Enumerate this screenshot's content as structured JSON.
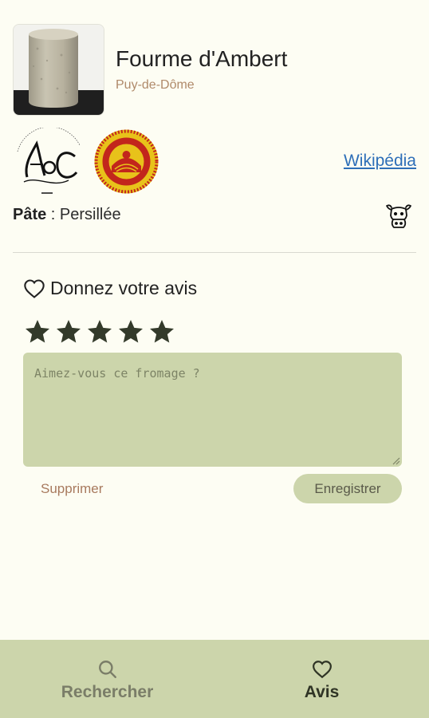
{
  "cheese": {
    "name": "Fourme d'Ambert",
    "region": "Puy-de-Dôme",
    "image_alt": "cheese-photo",
    "wiki_label": "Wikipédia",
    "pate_label": "Pâte",
    "pate_separator": " : ",
    "pate_value": "Persillée",
    "milk_icon": "cow-icon",
    "labels": [
      {
        "name": "AOC",
        "icon": "aoc-logo"
      },
      {
        "name": "AOP",
        "icon": "aop-logo"
      }
    ]
  },
  "review": {
    "title": "Donnez votre avis",
    "rating": 5,
    "max_rating": 5,
    "placeholder": "Aimez-vous ce fromage ?",
    "value": "",
    "delete_label": "Supprimer",
    "save_label": "Enregistrer"
  },
  "nav": {
    "items": [
      {
        "label": "Rechercher",
        "icon": "search-icon",
        "active": false
      },
      {
        "label": "Avis",
        "icon": "heart-icon",
        "active": true
      }
    ]
  },
  "colors": {
    "background": "#fdfdf3",
    "accent": "#ccd5ab",
    "star": "#333a2a",
    "region": "#b08a6a",
    "link": "#2e6fb8"
  }
}
